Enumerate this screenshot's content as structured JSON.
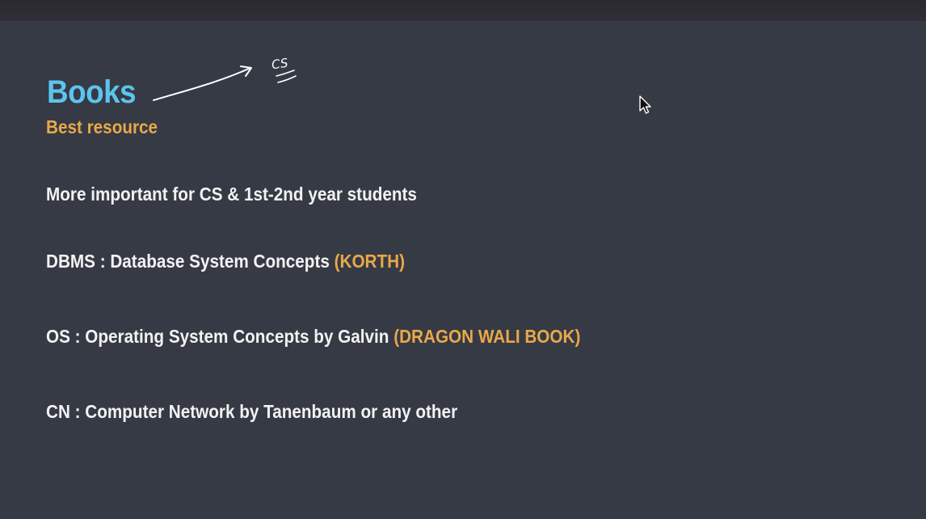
{
  "slide": {
    "title": "Books",
    "subtitle": "Best resource",
    "lines": [
      {
        "text": "More important for CS & 1st-2nd year students",
        "highlight": ""
      },
      {
        "text": "DBMS : Database System Concepts ",
        "highlight": "(KORTH)"
      },
      {
        "text": "OS : Operating System Concepts by Galvin ",
        "highlight": "(DRAGON WALI BOOK)"
      },
      {
        "text": "CN : Computer Network by Tanenbaum or any other",
        "highlight": ""
      }
    ],
    "annotation": "CS"
  },
  "colors": {
    "background": "#363a45",
    "title": "#5cc4ee",
    "accent": "#e8a84a",
    "text": "#f2f2f2"
  },
  "icons": {
    "cursor": "mouse-pointer-icon",
    "annotation_arrow": "hand-drawn-arrow-icon"
  }
}
